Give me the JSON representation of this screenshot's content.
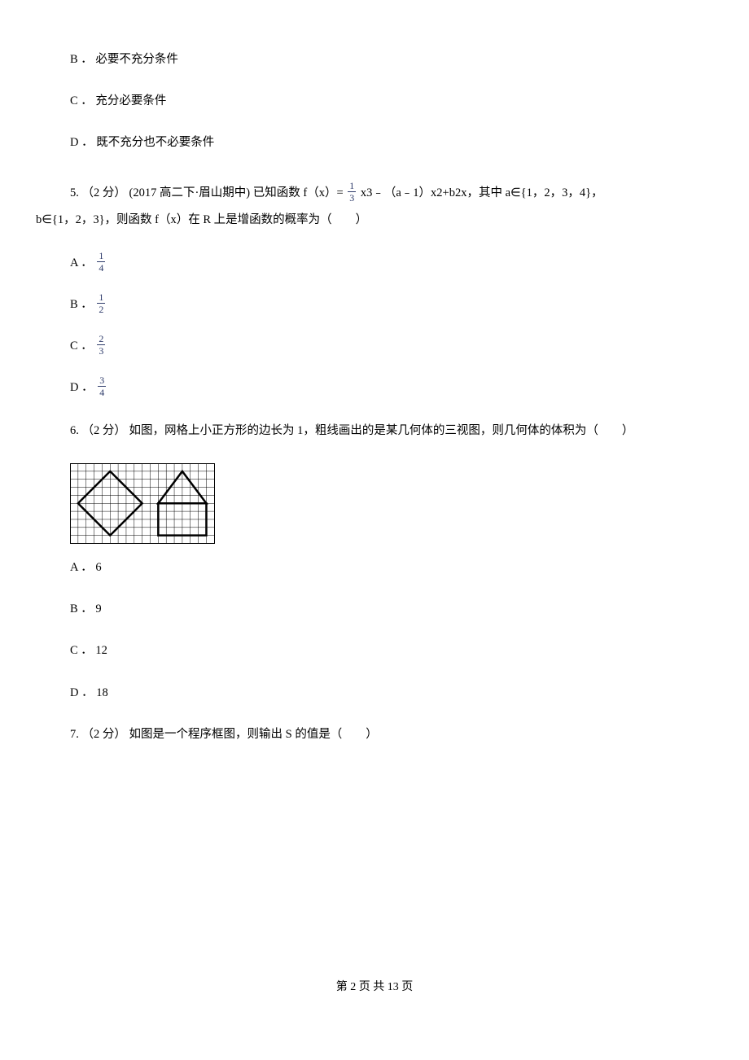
{
  "q4_options": {
    "B": "B ． 必要不充分条件",
    "C": "C ． 充分必要条件",
    "D": "D ． 既不充分也不必要条件"
  },
  "q5": {
    "line1_a": "5. （2 分） (2017 高二下·眉山期中) 已知函数 f（x）= ",
    "frac1_num": "1",
    "frac1_den": "3",
    "line1_b": " x3﹣（a﹣1）x2+b2x，其中 a∈{1，2，3，4}，",
    "line2": "b∈{1，2，3}，则函数 f（x）在 R 上是增函数的概率为（　　）",
    "options": {
      "A_lead": "A ．",
      "A_num": "1",
      "A_den": "4",
      "B_lead": "B ．",
      "B_num": "1",
      "B_den": "2",
      "C_lead": "C ．",
      "C_num": "2",
      "C_den": "3",
      "D_lead": "D ．",
      "D_num": "3",
      "D_den": "4"
    }
  },
  "q6": {
    "stem": "6. （2 分） 如图，网格上小正方形的边长为 1，粗线画出的是某几何体的三视图，则几何体的体积为（　　）",
    "options": {
      "A": "A ． 6",
      "B": "B ． 9",
      "C": "C ． 12",
      "D": "D ． 18"
    }
  },
  "q7": {
    "stem": "7. （2 分） 如图是一个程序框图，则输出 S 的值是（　　）"
  },
  "footer": "第 2 页 共 13 页"
}
